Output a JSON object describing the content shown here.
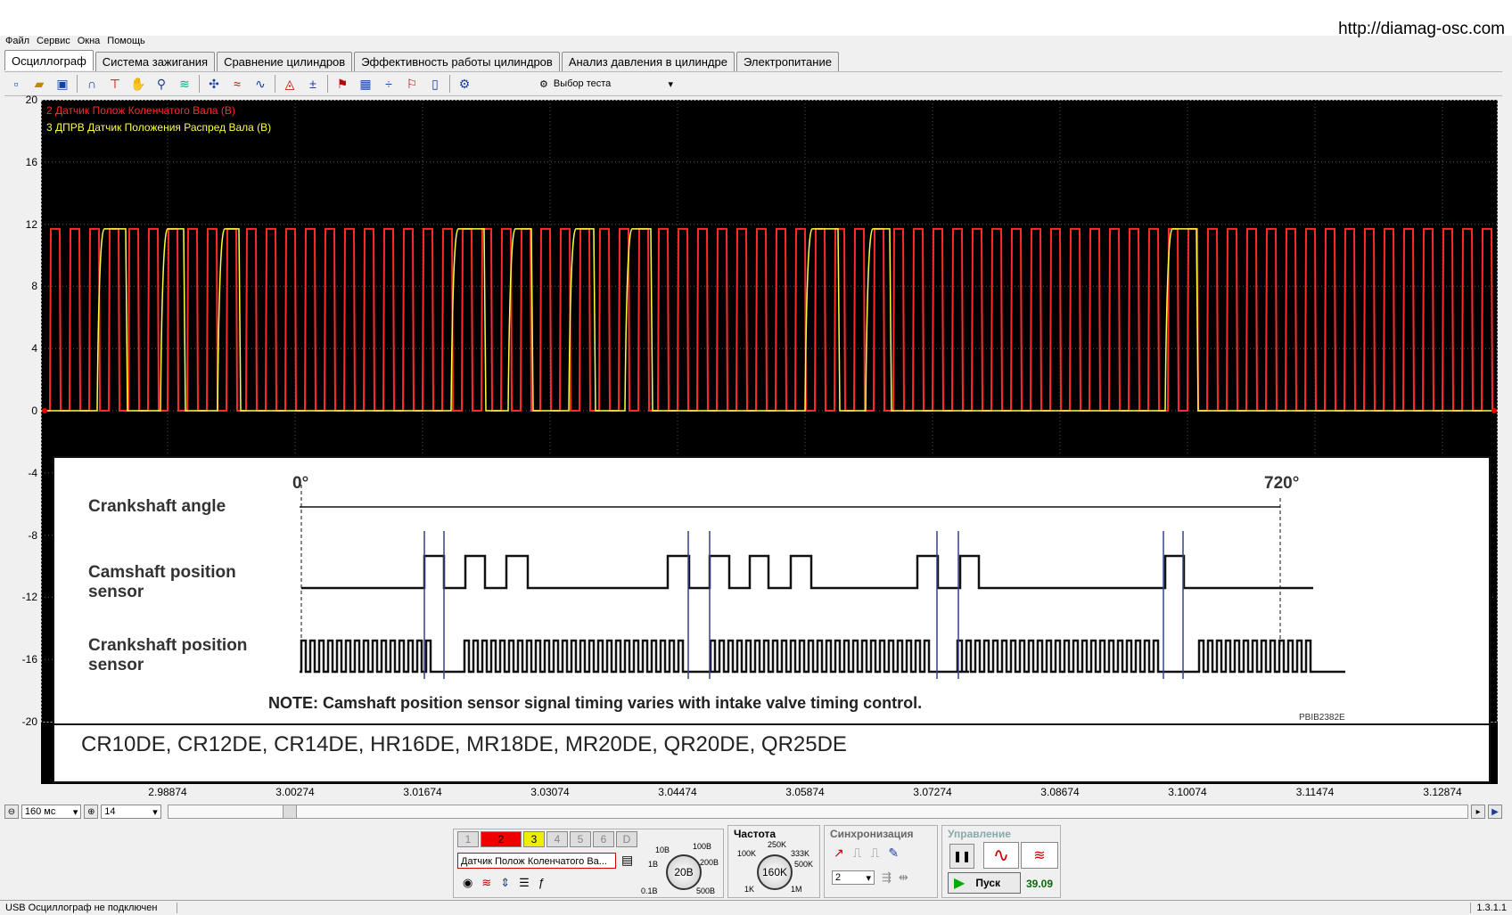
{
  "site_url": "http://diamag-osc.com",
  "menu": [
    "Файл",
    "Сервис",
    "Окна",
    "Помощь"
  ],
  "tabs": [
    "Осциллограф",
    "Система зажигания",
    "Сравнение цилиндров",
    "Эффективность работы цилиндров",
    "Анализ давления в цилиндре",
    "Электропитание"
  ],
  "toolbar": {
    "test_select": "Выбор теста"
  },
  "scope": {
    "y_ticks": [
      "20",
      "16",
      "12",
      "8",
      "4",
      "0",
      "-4",
      "-8",
      "-12",
      "-16",
      "-20"
    ],
    "x_ticks": [
      "2.98874",
      "3.00274",
      "3.01674",
      "3.03074",
      "3.04474",
      "3.05874",
      "3.07274",
      "3.08674",
      "3.10074",
      "3.11474",
      "3.12874"
    ],
    "channels": [
      {
        "label": "2 Датчик Полож Коленчатого Вала (В)",
        "color": "#ff2a2a"
      },
      {
        "label": "3 ДПРВ Датчик Положения Распред Вала (В)",
        "color": "#ffff40"
      }
    ],
    "signal_high": 11.7,
    "signal_low": 0,
    "marker_left": "1",
    "marker_right": "2"
  },
  "reference": {
    "crank_angle_label": "Crankshaft angle",
    "angle_start": "0°",
    "angle_end": "720°",
    "cam_label_1": "Camshaft position",
    "cam_label_2": "sensor",
    "crank_label_1": "Crankshaft position",
    "crank_label_2": "sensor",
    "note": "NOTE: Camshaft position sensor signal timing varies with intake valve timing control.",
    "code": "PBIB2382E",
    "engines": "CR10DE, CR12DE, CR14DE, HR16DE, MR18DE, MR20DE, QR20DE, QR25DE"
  },
  "bottom": {
    "timebase": "160 мс",
    "zoom": "14",
    "channel_buttons": [
      "1",
      "2",
      "3",
      "4",
      "5",
      "6",
      "D"
    ],
    "channel_name": "Датчик Полож Коленчатого Ва...",
    "volt_dial": {
      "value": "20В",
      "labels": [
        "10В",
        "100В",
        "1В",
        "200В",
        "0.1В",
        "500В"
      ]
    },
    "freq_title": "Частота",
    "freq_dial": {
      "value": "160K",
      "labels": [
        "250K",
        "100K",
        "333K",
        "500K",
        "1K",
        "1M"
      ]
    },
    "sync_title": "Синхронизация",
    "sync_channel": "2",
    "control_title": "Управление",
    "start_label": "Пуск",
    "counter": "39.09"
  },
  "status": {
    "left": "USB Осциллограф не подключен",
    "version": "1.3.1.1"
  }
}
